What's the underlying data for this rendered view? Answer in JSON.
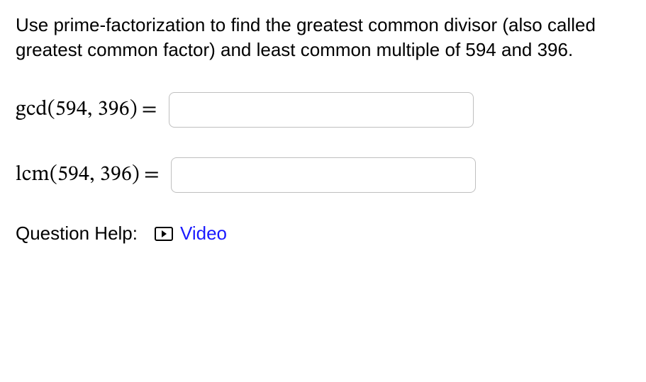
{
  "question": {
    "text": "Use prime-factorization to find the greatest common divisor (also called greatest common factor) and least common multiple of 594 and 396."
  },
  "answers": {
    "gcd": {
      "label_func": "gcd",
      "label_args": "(594, 396)",
      "eq": "=",
      "value": ""
    },
    "lcm": {
      "label_func": "lcm",
      "label_args": "(594, 396)",
      "eq": "=",
      "value": ""
    }
  },
  "help": {
    "label": "Question Help:",
    "video_text": "Video"
  }
}
